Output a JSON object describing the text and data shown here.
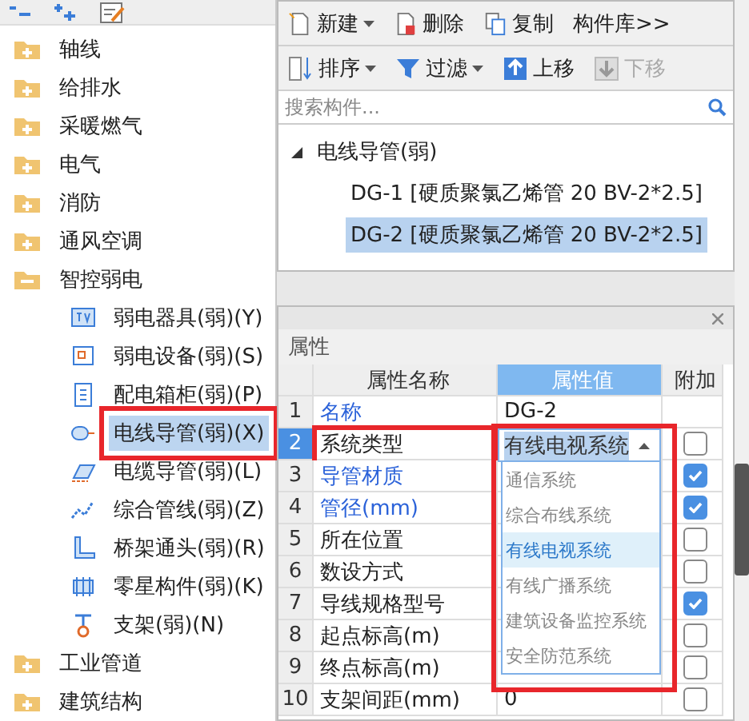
{
  "left_tree": {
    "items": [
      {
        "label": "轴线",
        "expanded": false
      },
      {
        "label": "给排水",
        "expanded": false
      },
      {
        "label": "采暖燃气",
        "expanded": false
      },
      {
        "label": "电气",
        "expanded": false
      },
      {
        "label": "消防",
        "expanded": false
      },
      {
        "label": "通风空调",
        "expanded": false
      },
      {
        "label": "智控弱电",
        "expanded": true,
        "children": [
          {
            "label": "弱电器具(弱)(Y)",
            "selected": false,
            "annotated": false
          },
          {
            "label": "弱电设备(弱)(S)",
            "selected": false,
            "annotated": false
          },
          {
            "label": "配电箱柜(弱)(P)",
            "selected": false,
            "annotated": false
          },
          {
            "label": "电线导管(弱)(X)",
            "selected": true,
            "annotated": true
          },
          {
            "label": "电缆导管(弱)(L)",
            "selected": false,
            "annotated": false
          },
          {
            "label": "综合管线(弱)(Z)",
            "selected": false,
            "annotated": false
          },
          {
            "label": "桥架通头(弱)(R)",
            "selected": false,
            "annotated": false
          },
          {
            "label": "零星构件(弱)(K)",
            "selected": false,
            "annotated": false
          },
          {
            "label": "支架(弱)(N)",
            "selected": false,
            "annotated": false
          }
        ]
      },
      {
        "label": "工业管道",
        "expanded": false
      },
      {
        "label": "建筑结构",
        "expanded": false
      }
    ]
  },
  "toolbar": [
    {
      "label": "新建",
      "has_menu": true
    },
    {
      "label": "删除",
      "has_menu": false
    },
    {
      "label": "复制",
      "has_menu": false
    },
    {
      "label": "构件库>>",
      "has_menu": false
    }
  ],
  "toolbar2": [
    {
      "label": "排序",
      "has_menu": true,
      "disabled": false
    },
    {
      "label": "过滤",
      "has_menu": true,
      "disabled": false
    },
    {
      "label": "上移",
      "has_menu": false,
      "disabled": false
    },
    {
      "label": "下移",
      "has_menu": false,
      "disabled": true
    }
  ],
  "search": {
    "placeholder": "搜索构件..."
  },
  "component_tree": {
    "label": "电线导管(弱)",
    "expanded": true,
    "children": [
      {
        "label": "DG-1 [硬质聚氯乙烯管 20 BV-2*2.5]",
        "selected": false
      },
      {
        "label": "DG-2 [硬质聚氯乙烯管 20 BV-2*2.5]",
        "selected": true
      }
    ]
  },
  "properties": {
    "title": "属性",
    "columns": [
      "属性名称",
      "属性值",
      "附加"
    ],
    "rows": [
      {
        "index": "1",
        "name": "名称",
        "emphasized": true,
        "value": "DG-2",
        "selected": false,
        "annotated": false
      },
      {
        "index": "2",
        "name": "系统类型",
        "emphasized": false,
        "value": "有线电视系统",
        "selected": true,
        "annotated": true,
        "checked": false
      },
      {
        "index": "3",
        "name": "导管材质",
        "emphasized": true,
        "selected": false,
        "checked": true
      },
      {
        "index": "4",
        "name": "管径(mm)",
        "emphasized": true,
        "selected": false,
        "checked": true
      },
      {
        "index": "5",
        "name": "所在位置",
        "emphasized": false,
        "selected": false,
        "checked": false
      },
      {
        "index": "6",
        "name": "数设方式",
        "emphasized": false,
        "selected": false,
        "checked": false
      },
      {
        "index": "7",
        "name": "导线规格型号",
        "emphasized": false,
        "selected": false,
        "checked": true
      },
      {
        "index": "8",
        "name": "起点标高(m)",
        "emphasized": false,
        "selected": false,
        "checked": false
      },
      {
        "index": "9",
        "name": "终点标高(m)",
        "emphasized": false,
        "selected": false,
        "checked": false
      },
      {
        "index": "10",
        "name": "支架间距(mm)",
        "emphasized": false,
        "selected": false,
        "value": "0",
        "checked": false
      }
    ],
    "dropdown": {
      "annotated": true,
      "options": [
        {
          "label": "通信系统",
          "selected": false
        },
        {
          "label": "综合布线系统",
          "selected": false
        },
        {
          "label": "有线电视系统",
          "selected": true
        },
        {
          "label": "有线广播系统",
          "selected": false
        },
        {
          "label": "建筑设备监控系统",
          "selected": false
        },
        {
          "label": "安全防范系统",
          "selected": false
        }
      ]
    }
  }
}
